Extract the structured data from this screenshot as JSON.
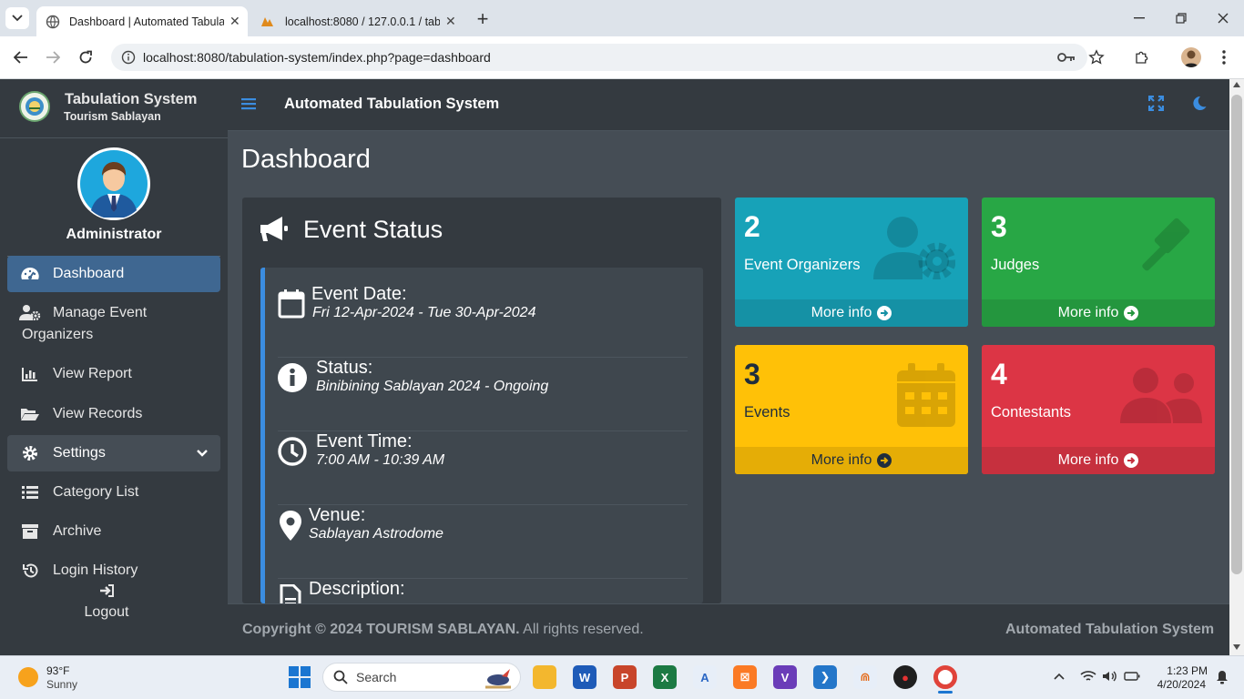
{
  "browser": {
    "tabs": [
      {
        "title": "Dashboard | Automated Tabula",
        "active": true
      },
      {
        "title": "localhost:8080 / 127.0.0.1 / tab",
        "active": false
      }
    ],
    "url": "localhost:8080/tabulation-system/index.php?page=dashboard"
  },
  "sidebar": {
    "brand_name": "Tabulation System",
    "brand_sub": "Tourism Sablayan",
    "user": "Administrator",
    "items": [
      {
        "label": "Dashboard",
        "icon": "tachometer-icon"
      },
      {
        "label": "Manage Event",
        "label2": "Organizers",
        "icon": "user-gear-icon"
      },
      {
        "label": "View Report",
        "icon": "chart-bar-icon"
      },
      {
        "label": "View Records",
        "icon": "folder-open-icon"
      },
      {
        "label": "Settings",
        "icon": "gear-icon"
      },
      {
        "label": "Category List",
        "icon": "list-icon"
      },
      {
        "label": "Archive",
        "icon": "archive-icon"
      },
      {
        "label": "Login History",
        "icon": "history-icon"
      }
    ],
    "logout": "Logout"
  },
  "header": {
    "title": "Automated Tabulation System"
  },
  "page": {
    "title": "Dashboard"
  },
  "event_status": {
    "title": "Event Status",
    "items": [
      {
        "label": "Event Date:",
        "value": "Fri 12-Apr-2024 - Tue 30-Apr-2024",
        "icon": "calendar-icon"
      },
      {
        "label": "Status:",
        "value": "Binibining Sablayan 2024 - Ongoing",
        "icon": "info-circle-icon"
      },
      {
        "label": "Event Time:",
        "value": "7:00 AM - 10:39 AM",
        "icon": "clock-icon"
      },
      {
        "label": "Venue:",
        "value": "Sablayan Astrodome",
        "icon": "map-marker-icon"
      },
      {
        "label": "Description:",
        "value": "",
        "icon": "file-icon"
      }
    ]
  },
  "stats": [
    {
      "count": "2",
      "label": "Event Organizers",
      "more": "More info",
      "color": "#17a2b8",
      "foot_color": "#1591a5",
      "icon": "user-gear-icon"
    },
    {
      "count": "3",
      "label": "Judges",
      "more": "More info",
      "color": "#28a745",
      "foot_color": "#24963e",
      "icon": "gavel-icon"
    },
    {
      "count": "3",
      "label": "Events",
      "more": "More info",
      "color": "#ffc107",
      "foot_color": "#e5ad06",
      "icon": "calendar-icon"
    },
    {
      "count": "4",
      "label": "Contestants",
      "more": "More info",
      "color": "#dc3545",
      "foot_color": "#c6303e",
      "icon": "users-icon"
    }
  ],
  "footer": {
    "copyright": "Copyright © 2024",
    "org": "TOURISM SABLAYAN.",
    "rights": "All rights reserved.",
    "right": "Automated Tabulation System"
  },
  "taskbar": {
    "weather_temp": "93°F",
    "weather_desc": "Sunny",
    "search_placeholder": "Search",
    "time": "1:23 PM",
    "date": "4/20/2024"
  }
}
